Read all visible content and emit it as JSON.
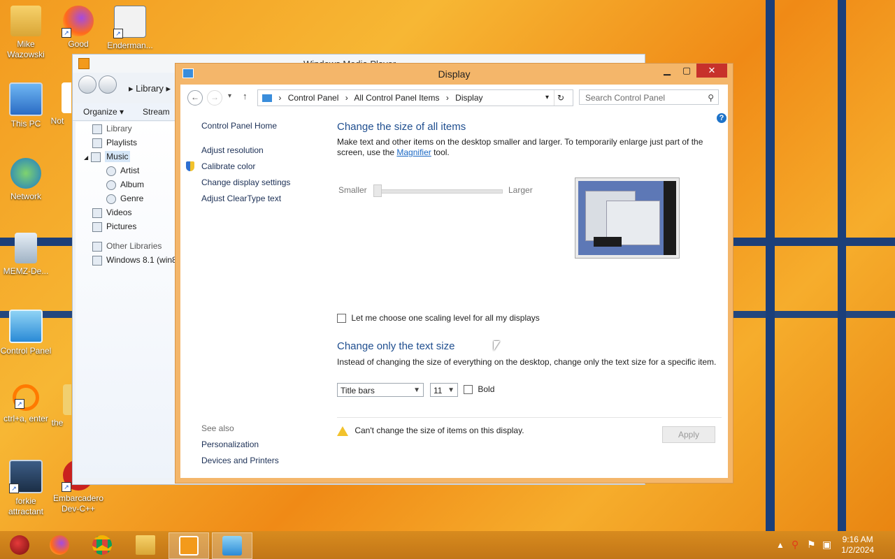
{
  "desktop": {
    "icons": [
      {
        "label": "Mike Wazowski",
        "icon": "folder-user-icon"
      },
      {
        "label": "Good",
        "icon": "firefox-icon"
      },
      {
        "label": "Enderman...",
        "icon": "shortcut-image-icon"
      },
      {
        "label": "This PC",
        "icon": "computer-icon"
      },
      {
        "label": "Network",
        "icon": "network-globe-icon"
      },
      {
        "label": "MEMZ-De...",
        "icon": "recycle-bin-icon"
      },
      {
        "label": "Control Panel",
        "icon": "control-panel-icon"
      },
      {
        "label": "ctrl+a, enter",
        "icon": "ring-shortcut-icon"
      },
      {
        "label": "forkie attractant",
        "icon": "settings-monitor-icon"
      },
      {
        "label": "Embarcadero Dev-C++",
        "icon": "devcpp-icon"
      },
      {
        "label": "Not",
        "icon": "partial-icon"
      },
      {
        "label": "the",
        "icon": "partial-folder-icon"
      }
    ]
  },
  "media_player": {
    "title": "Windows Media Player",
    "crumb": "Library",
    "toolbar": {
      "organize": "Organize",
      "stream": "Stream"
    },
    "tree": [
      "Library",
      "Playlists",
      "Music",
      "Artist",
      "Album",
      "Genre",
      "Videos",
      "Pictures",
      "Other Libraries",
      "Windows 8.1 (win8"
    ]
  },
  "display_window": {
    "title": "Display",
    "address": [
      "Control Panel",
      "All Control Panel Items",
      "Display"
    ],
    "search_placeholder": "Search Control Panel",
    "sidebar": {
      "home": "Control Panel Home",
      "links": [
        "Adjust resolution",
        "Calibrate color",
        "Change display settings",
        "Adjust ClearType text"
      ],
      "see_also_label": "See also",
      "see_also": [
        "Personalization",
        "Devices and Printers"
      ]
    },
    "section1": {
      "heading": "Change the size of all items",
      "desc_before": "Make text and other items on the desktop smaller and larger. To temporarily enlarge just part of the screen, use the ",
      "desc_link": "Magnifier",
      "desc_after": " tool.",
      "smaller": "Smaller",
      "larger": "Larger",
      "slider_value": 0
    },
    "checkbox_label": "Let me choose one scaling level for all my displays",
    "section2": {
      "heading": "Change only the text size",
      "desc": "Instead of changing the size of everything on the desktop, change only the text size for a specific item.",
      "item_select": "Title bars",
      "size_select": "11",
      "bold_label": "Bold"
    },
    "warning": "Can't change the size of items on this display.",
    "apply": "Apply",
    "help": "?"
  },
  "taskbar": {
    "items": [
      "ornament-icon",
      "firefox-icon",
      "chrome-icon",
      "file-explorer-icon",
      "media-player-icon",
      "control-panel-icon"
    ],
    "time": "9:16 AM",
    "date": "1/2/2024"
  },
  "colors": {
    "heading": "#1f4e8f",
    "link": "#1a68c4",
    "close": "#c7312b",
    "titlebar": "#f4b66a"
  }
}
